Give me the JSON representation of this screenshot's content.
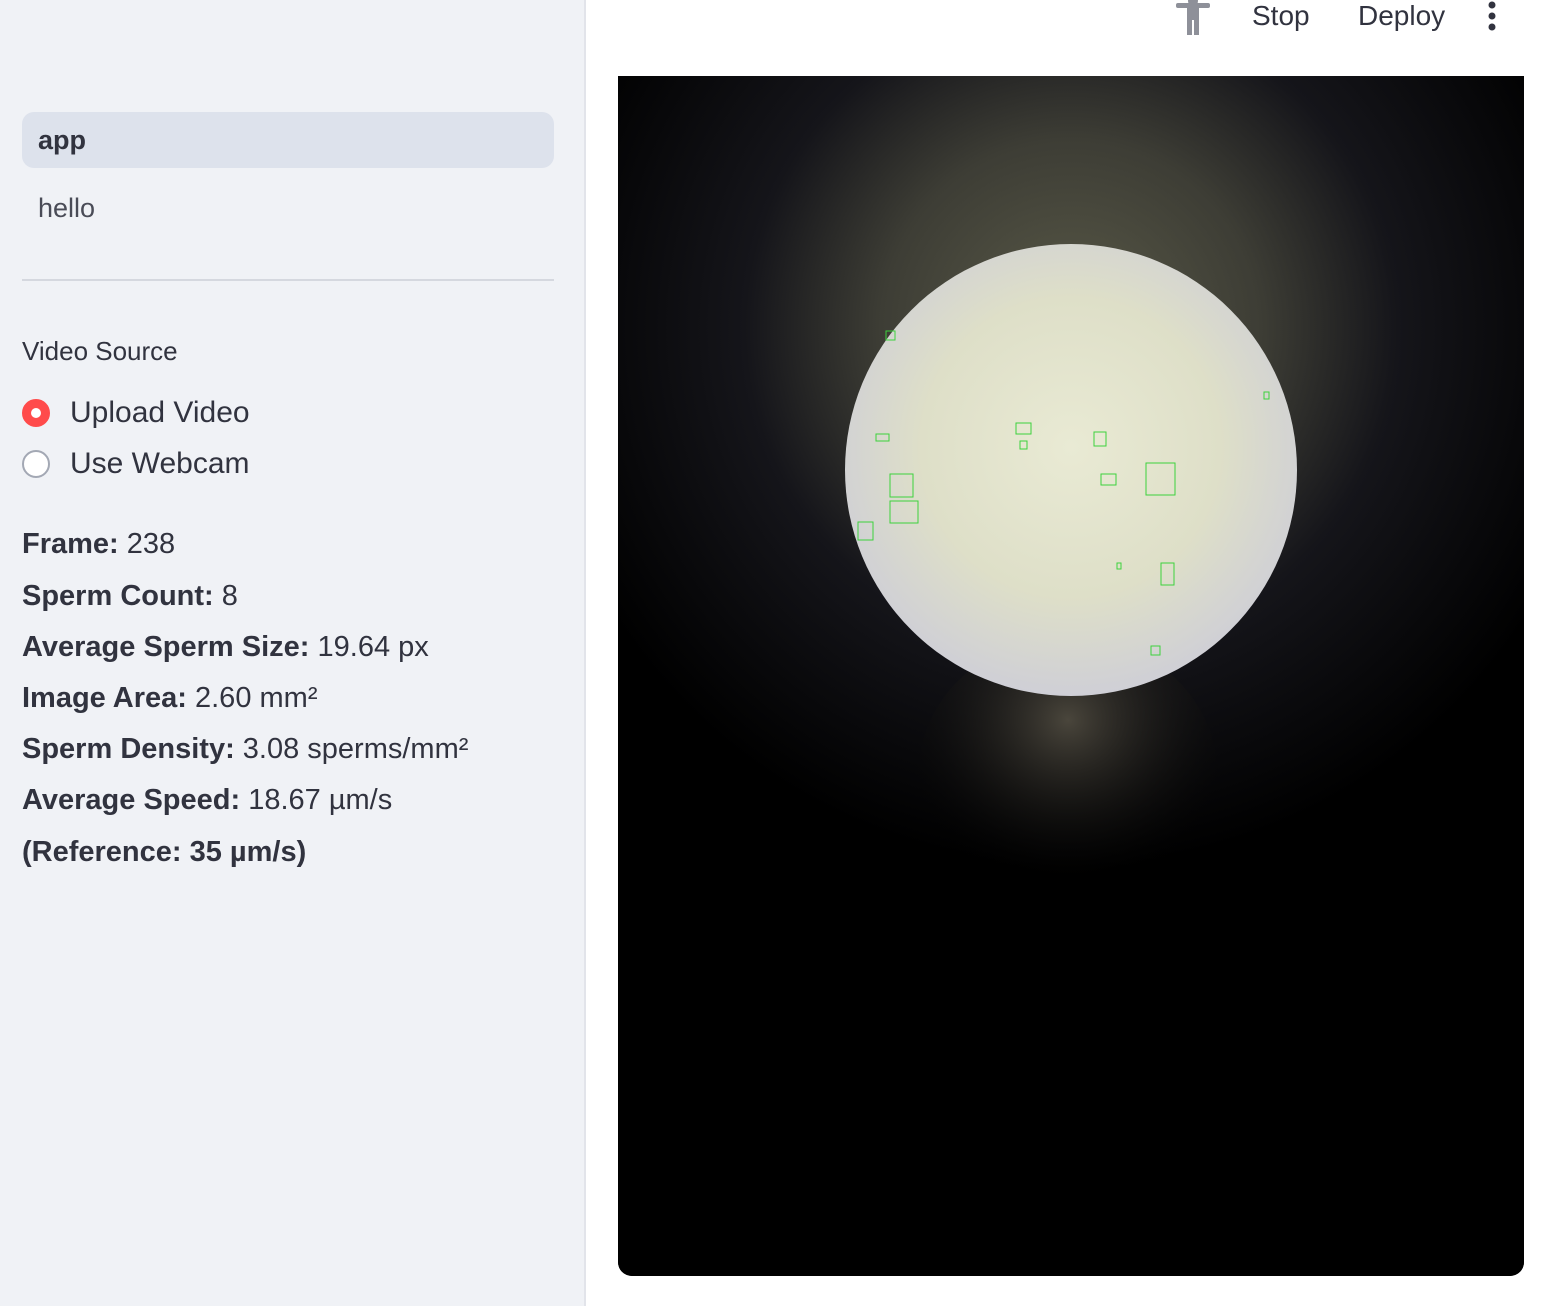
{
  "sidebar": {
    "nav": [
      {
        "label": "app",
        "active": true
      },
      {
        "label": "hello",
        "active": false
      }
    ],
    "video_source": {
      "label": "Video Source",
      "options": [
        {
          "label": "Upload Video",
          "selected": true
        },
        {
          "label": "Use Webcam",
          "selected": false
        }
      ]
    },
    "stats": [
      {
        "label": "Frame:",
        "value": "238"
      },
      {
        "label": "Sperm Count:",
        "value": "8"
      },
      {
        "label": "Average Sperm Size:",
        "value": "19.64 px"
      },
      {
        "label": "Image Area:",
        "value": "2.60 mm²"
      },
      {
        "label": "Sperm Density:",
        "value": "3.08 sperms/mm²"
      },
      {
        "label": "Average Speed:",
        "value": "18.67 µm/s"
      },
      {
        "label": "(Reference: 35 µm/s)",
        "value": ""
      }
    ]
  },
  "header": {
    "running_icon": "running-person-icon",
    "stop_label": "Stop",
    "deploy_label": "Deploy",
    "menu_icon": "kebab-menu-icon"
  },
  "colors": {
    "accent": "#ff4b4b",
    "sidebar_bg": "#f0f2f6",
    "detection_box": "#3cd23c",
    "text": "#31333f"
  }
}
